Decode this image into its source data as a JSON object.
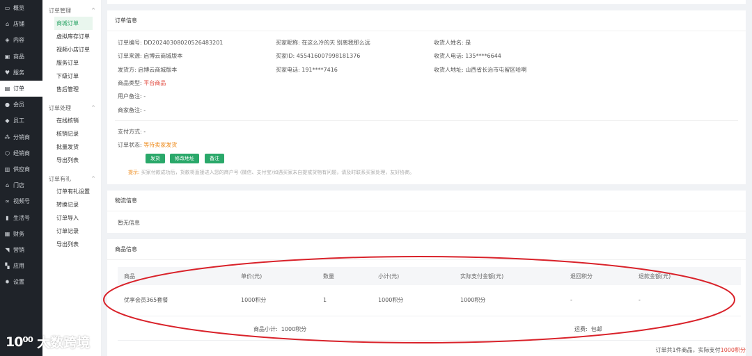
{
  "nav": [
    {
      "label": "概览",
      "icon": "monitor-icon"
    },
    {
      "label": "店铺",
      "icon": "store-icon"
    },
    {
      "label": "内容",
      "icon": "layers-icon"
    },
    {
      "label": "商品",
      "icon": "goods-icon"
    },
    {
      "label": "服务",
      "icon": "heart-icon"
    },
    {
      "label": "订单",
      "icon": "order-icon",
      "active": true
    },
    {
      "label": "会员",
      "icon": "user-icon"
    },
    {
      "label": "员工",
      "icon": "staff-icon"
    },
    {
      "label": "分销商",
      "icon": "distributor-icon"
    },
    {
      "label": "经销商",
      "icon": "dealer-icon"
    },
    {
      "label": "供应商",
      "icon": "supplier-icon"
    },
    {
      "label": "门店",
      "icon": "shop-icon"
    },
    {
      "label": "视频号",
      "icon": "video-icon"
    },
    {
      "label": "生活号",
      "icon": "bookmark-icon"
    },
    {
      "label": "财务",
      "icon": "finance-icon"
    },
    {
      "label": "营销",
      "icon": "tag-icon"
    },
    {
      "label": "应用",
      "icon": "apps-icon"
    },
    {
      "label": "设置",
      "icon": "gear-icon"
    }
  ],
  "submenu": {
    "groups": [
      {
        "title": "订单管理",
        "items": [
          "商城订单",
          "虚拟库存订单",
          "视频小店订单",
          "服务订单",
          "下级订单",
          "售后管理"
        ]
      },
      {
        "title": "订单处理",
        "items": [
          "在线核销",
          "核销记录",
          "批量发货",
          "导出列表"
        ]
      },
      {
        "title": "订单有礼",
        "items": [
          "订单有礼设置",
          "转换记录",
          "订单导入",
          "订单记录",
          "导出列表"
        ]
      }
    ],
    "active_item": "商城订单"
  },
  "order_info": {
    "title": "订单信息",
    "order_no_label": "订单编号:",
    "order_no": "DD20240308020526483201",
    "source_label": "订单来源:",
    "source": "启博云商城版本",
    "shipper_label": "发货方:",
    "shipper": "启博云商城版本",
    "goods_type_label": "商品类型:",
    "goods_type": "平台商品",
    "user_note_label": "用户备注:",
    "user_note": "-",
    "merchant_note_label": "商家备注:",
    "merchant_note": "-",
    "buyer_nick_label": "买家昵称:",
    "buyer_nick": "在这么冷的天 别离我那么远",
    "buyer_id_label": "买家ID:",
    "buyer_id": "455416007998181376",
    "buyer_phone_label": "买家电话:",
    "buyer_phone": "191****7416",
    "receiver_name_label": "收货人姓名:",
    "receiver_name": "是",
    "receiver_phone_label": "收货人电话:",
    "receiver_phone": "135****6644",
    "receiver_addr_label": "收货人地址:",
    "receiver_addr": "山西省长治市屯留区哈啊",
    "pay_method_label": "支付方式:",
    "pay_method": "-",
    "status_label": "订单状态:",
    "status": "等待卖家发货",
    "buttons": {
      "ship": "发货",
      "edit_address": "修改地址",
      "note": "备注"
    },
    "tip_label": "提示:",
    "tip_text": "买家付款成功后，货款将直接进入您的商户号 (微信、支付宝)如遇买家未自提或货物有问题，请及时联系买家处理，友好协商。"
  },
  "logistics": {
    "title": "物流信息",
    "empty": "暂无信息"
  },
  "goods": {
    "title": "商品信息",
    "columns": [
      "商品",
      "单价(元)",
      "数量",
      "小计(元)",
      "实际支付金额(元)",
      "退回积分",
      "退款金额(元)"
    ],
    "rows": [
      [
        "优享会员365套餐",
        "1000积分",
        "1",
        "1000积分",
        "1000积分",
        "-",
        "-"
      ]
    ],
    "subtotal_label": "商品小计:",
    "subtotal": "1000积分",
    "freight_label": "运费:",
    "freight": "包邮",
    "summary_prefix": "订单共1件商品，实际支付",
    "summary_amount": "1000积分"
  },
  "watermark": {
    "logo": "10⁰⁰",
    "text": "大数跨境"
  },
  "colors": {
    "accent": "#2aa86a",
    "danger": "#e0463b",
    "warning": "#ee8a1a",
    "nav_bg": "#1f2329",
    "annotation": "#d9222a"
  }
}
